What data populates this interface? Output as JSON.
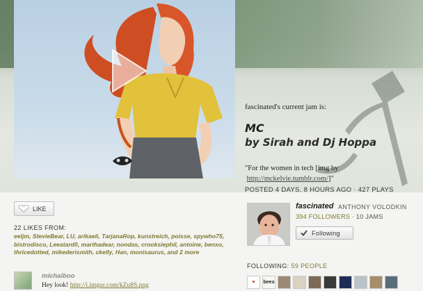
{
  "jam": {
    "kicker": "fascinated's current jam is:",
    "title": "MC",
    "artist": "by Sirah and Dj Hoppa",
    "caption_prefix": "\"For the women in tech [img by ",
    "caption_link": "http://mckelvie.tumblr.com/",
    "caption_suffix": "]\"",
    "meta": "POSTED 4 DAYS, 8 HOURS AGO · 427 PLAYS"
  },
  "likes": {
    "button_label": "LIKE",
    "header": "22 LIKES FROM:",
    "users": [
      "eeljm",
      "StevieBear",
      "LU",
      "arikaeli",
      "TarjanaRop",
      "kunstreich",
      "poisse",
      "spywho75",
      "bistrodisco",
      "Leeatard0",
      "marthadear",
      "nondas",
      "crooksiephil",
      "antoine",
      "benxo",
      "thricedotted",
      "mikederismith",
      "ckelly",
      "Han",
      "monisaurus"
    ],
    "and_more": "and 2 more"
  },
  "comment": {
    "user": "michalboo",
    "text_prefix": "Hey look! ",
    "link": "http://i.imgur.com/kZu8S.png"
  },
  "profile": {
    "username": "fascinated",
    "real_name": "ANTHONY VOLODKIN",
    "followers": "394 FOLLOWERS",
    "jams": " · 10 JAMS",
    "following_button": "Following",
    "following_label": "FOLLOWING:",
    "following_count": "59 PEOPLE"
  },
  "following_avatars": [
    {
      "label": "♥",
      "bg": "#ffffff"
    },
    {
      "label": "bees",
      "bg": "#f6f6f2"
    },
    {
      "label": "",
      "bg": "#9c8a74"
    },
    {
      "label": "",
      "bg": "#d9d2c3"
    },
    {
      "label": "",
      "bg": "#7c6a55"
    },
    {
      "label": "",
      "bg": "#3a3a3a"
    },
    {
      "label": "",
      "bg": "#1e2d55"
    },
    {
      "label": "",
      "bg": "#b9c3c8"
    },
    {
      "label": "",
      "bg": "#a78d6c"
    },
    {
      "label": "",
      "bg": "#5a6e7a"
    }
  ],
  "colors": {
    "accent": "#7d7a2e",
    "hero_green": "#6f8c6d",
    "shirt_yellow": "#e2c13b",
    "hair": "#d8562a"
  }
}
